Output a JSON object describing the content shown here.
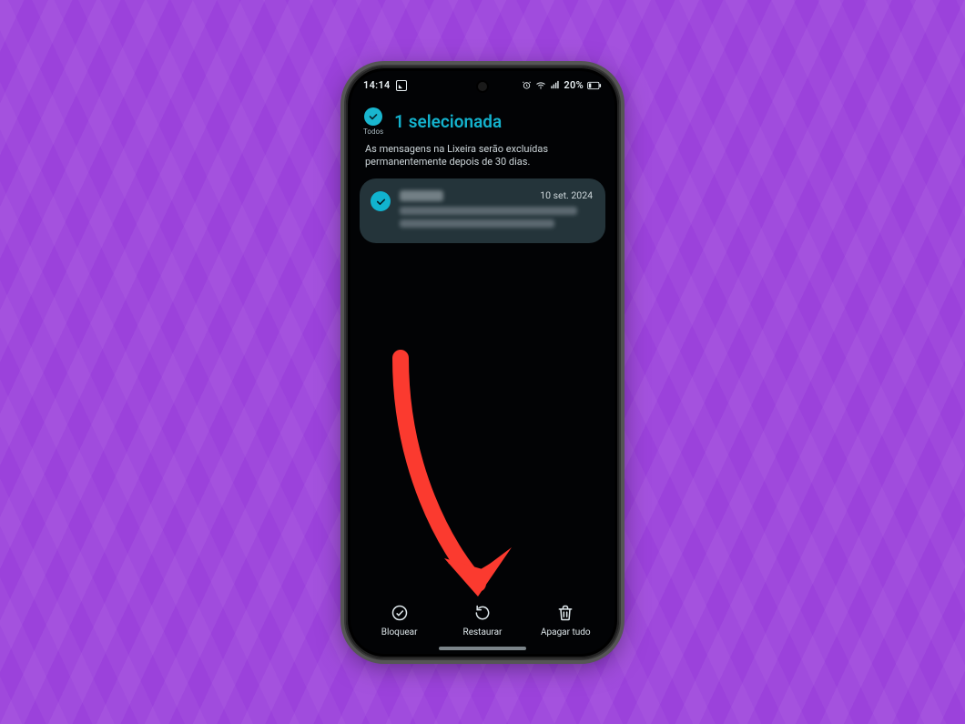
{
  "status_bar": {
    "time": "14:14",
    "battery_text": "20%"
  },
  "header": {
    "select_all_label": "Todos",
    "title": "1 selecionada"
  },
  "info_text": "As mensagens na Lixeira serão excluídas permanentemente depois de 30 dias.",
  "message": {
    "date": "10 set. 2024"
  },
  "actions": {
    "block": "Bloquear",
    "restore": "Restaurar",
    "delete_all": "Apagar tudo"
  },
  "colors": {
    "accent": "#14b2cd",
    "bg_purple": "#9b42db",
    "arrow": "#fb3a2f"
  }
}
